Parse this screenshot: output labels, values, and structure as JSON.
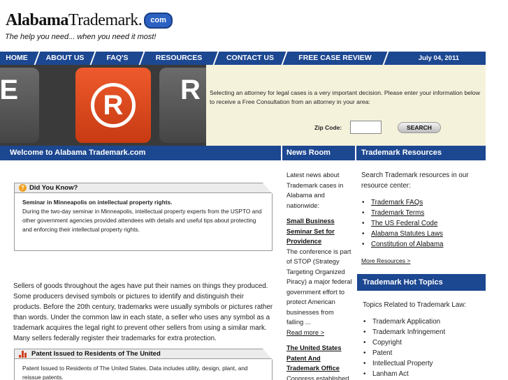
{
  "header": {
    "logo_bold": "Alabama",
    "logo_regular": "Trademark.",
    "logo_badge": "com",
    "tagline": "The help you need... when you need it most!"
  },
  "nav": {
    "items": [
      "HOME",
      "ABOUT US",
      "FAQ'S",
      "RESOURCES",
      "CONTACT US",
      "FREE CASE REVIEW"
    ],
    "date": "July 04, 2011"
  },
  "hero": {
    "key_left": "E",
    "key_center": "R",
    "key_right": "R",
    "intro": "Selecting an attorney for legal cases is a very important decision. Please enter your information below to receive a Free Consultation from an attorney in your area:",
    "zip_label": "Zip Code:",
    "zip_value": "",
    "search_label": "SEARCH"
  },
  "bars": {
    "welcome": "Welcome to Alabama Trademark.com",
    "news": "News Room",
    "resources": "Trademark Resources"
  },
  "did_you_know": {
    "title": "Did You Know?",
    "headline": "Seminar in Minneapolis on intellectual property rights.",
    "body": "During the two-day seminar in Minneapolis, intellectual property experts from the USPTO and other government agencies provided attendees with details and useful tips about protecting and enforcing their intellectual property rights."
  },
  "main_text": "Sellers of goods throughout the ages have put their names on things they produced. Some producers devised symbols or pictures to identify and distinguish their products. Before the 20th century, trademarks were usually symbols or pictures rather than words. Under the common law in each state, a seller who uses any symbol as a trademark acquires the legal right to prevent other sellers from using a similar mark. Many sellers federally register their trademarks for extra protection.",
  "patent_box": {
    "title": "Patent Issued to Residents of The United",
    "body": "Patent Issued to Residents of The United States. Data includes utility, design, plant, and reissue patents."
  },
  "news": {
    "intro": "Latest news about Trademark cases in Alabama and nationwide:",
    "item1_title": "Small Business Seminar Set for Providence",
    "item1_body": "The conference is part of STOP (Strategy Targeting Organized Piracy) a major federal government effort to protect American businesses from falling ...",
    "read_more": "Read more >",
    "item2_title": "The United States Patent And Trademark Office",
    "item2_body": "Congress established"
  },
  "resources": {
    "intro": "Search Trademark resources in our resource center:",
    "links": [
      "Trademark FAQs",
      "Trademark Terms",
      "The US Federal Code",
      "Alabama Statutes Laws",
      "Constitution of Alabama"
    ],
    "more": "More Resources >",
    "hot_title": "Trademark Hot Topics",
    "hot_intro": "Topics Related to Trademark Law:",
    "hot_items": [
      "Trademark Application",
      "Trademark Infringement",
      "Copyright",
      "Patent",
      "Intellectual Property",
      "Lanham Act"
    ]
  },
  "colors": {
    "nav_blue": "#1c4791",
    "hero_bg": "#f5f2dc",
    "key_orange": "#e04a1e"
  }
}
